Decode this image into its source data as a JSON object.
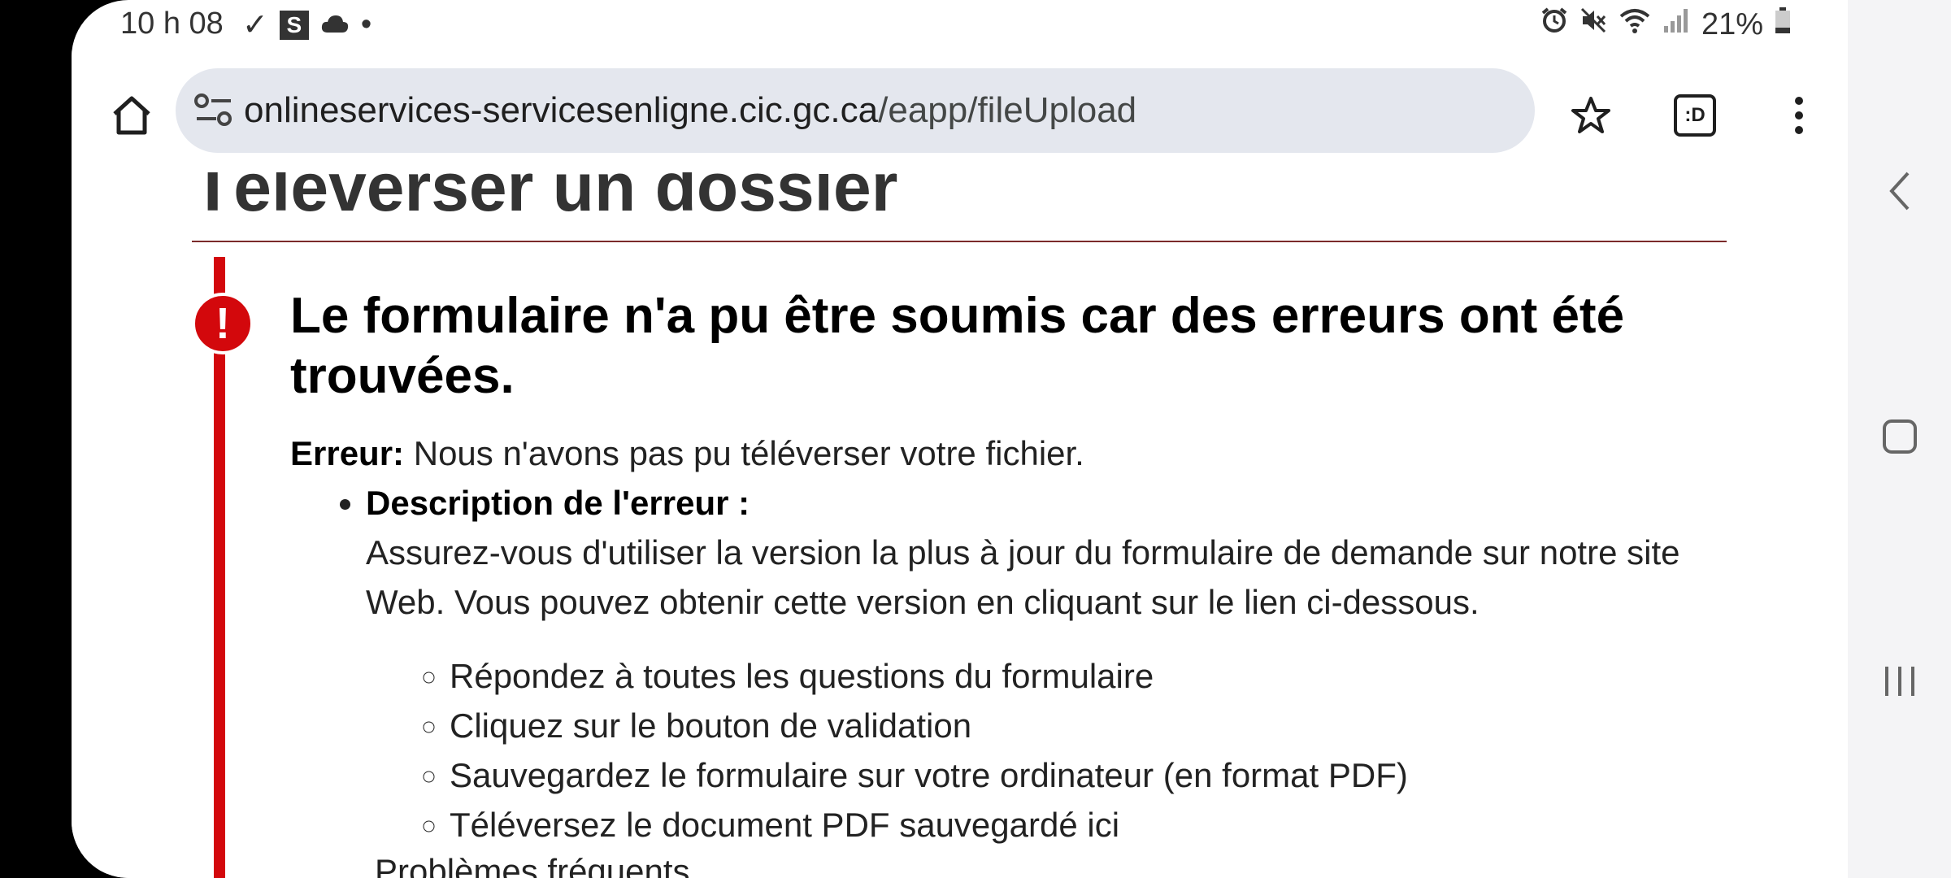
{
  "status_bar": {
    "time": "10 h 08",
    "battery": "21%"
  },
  "browser": {
    "url_host": "onlineservices-servicesenligne.cic.gc.ca",
    "url_path": "/eapp/fileUpload",
    "tab_badge": ":D"
  },
  "page": {
    "title": "Téléverser un dossier",
    "alert": {
      "heading": "Le formulaire n'a pu être soumis car des erreurs ont été trouvées.",
      "error_label": "Erreur:",
      "error_text": " Nous n'avons pas pu téléverser votre fichier.",
      "description_title": "Description de l'erreur :",
      "description_text": "Assurez-vous d'utiliser la version la plus à jour du formulaire de demande sur notre site Web. Vous pouvez obtenir cette version en cliquant sur le lien ci-dessous.",
      "steps": [
        "Répondez à toutes les questions du formulaire",
        "Cliquez sur le bouton de validation",
        "Sauvegardez le formulaire sur votre ordinateur (en format PDF)",
        "Téléversez le document PDF sauvegardé ici"
      ],
      "frequent_problems": "Problèmes fréquents"
    }
  },
  "icons": {
    "alarm": "alarm-icon",
    "mute": "mute-icon",
    "wifi": "wifi-icon",
    "signal": "signal-icon",
    "battery": "battery-icon",
    "home": "home-icon",
    "star": "star-icon",
    "menu": "more-vert-icon"
  },
  "colors": {
    "alert_red": "#d3080c",
    "url_bar_bg": "#e4e7ee"
  }
}
